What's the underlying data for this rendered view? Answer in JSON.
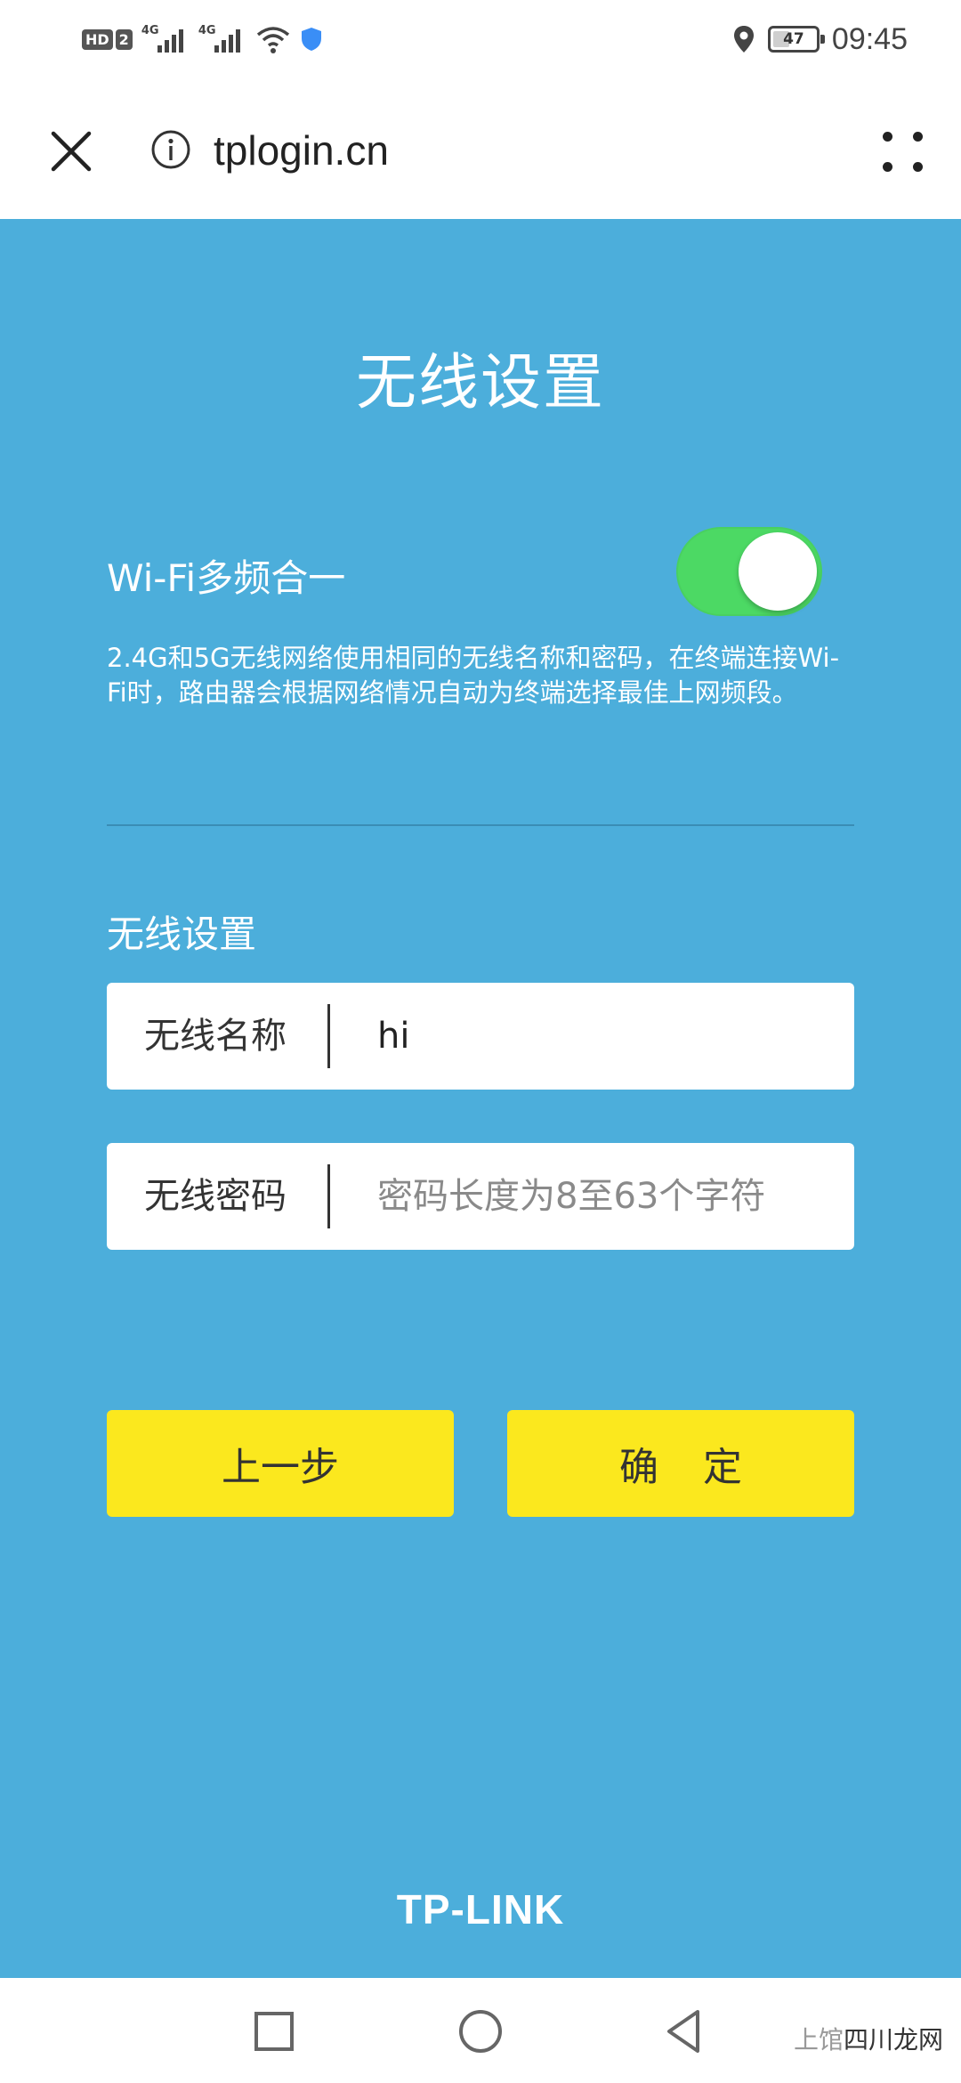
{
  "status_bar": {
    "hd1": "HD",
    "hd2": "2",
    "signal1_tag": "4G",
    "signal2_tag": "4G",
    "battery_level": "47",
    "battery_fraction": 0.47,
    "time": "09:45",
    "icons": [
      "wifi-icon",
      "shield-icon",
      "location-icon",
      "battery-icon"
    ]
  },
  "browser": {
    "url": "tplogin.cn"
  },
  "page": {
    "title": "无线设置",
    "wifi_combine_label": "Wi-Fi多频合一",
    "wifi_combine_enabled": true,
    "wifi_combine_desc": "2.4G和5G无线网络使用相同的无线名称和密码，在终端连接Wi-Fi时，路由器会根据网络情况自动为终端选择最佳上网频段。",
    "section_label": "无线设置",
    "ssid_label": "无线名称",
    "ssid_value": "hi",
    "password_label": "无线密码",
    "password_placeholder": "密码长度为8至63个字符",
    "prev_button": "上一步",
    "ok_button": "确 定",
    "logo": "TP-LINK"
  },
  "nav": {
    "watermark_a": "上馆",
    "watermark_b": "四川龙网"
  },
  "colors": {
    "background": "#4caedb",
    "button": "#fbe81e",
    "toggle_on": "#4cd964"
  }
}
